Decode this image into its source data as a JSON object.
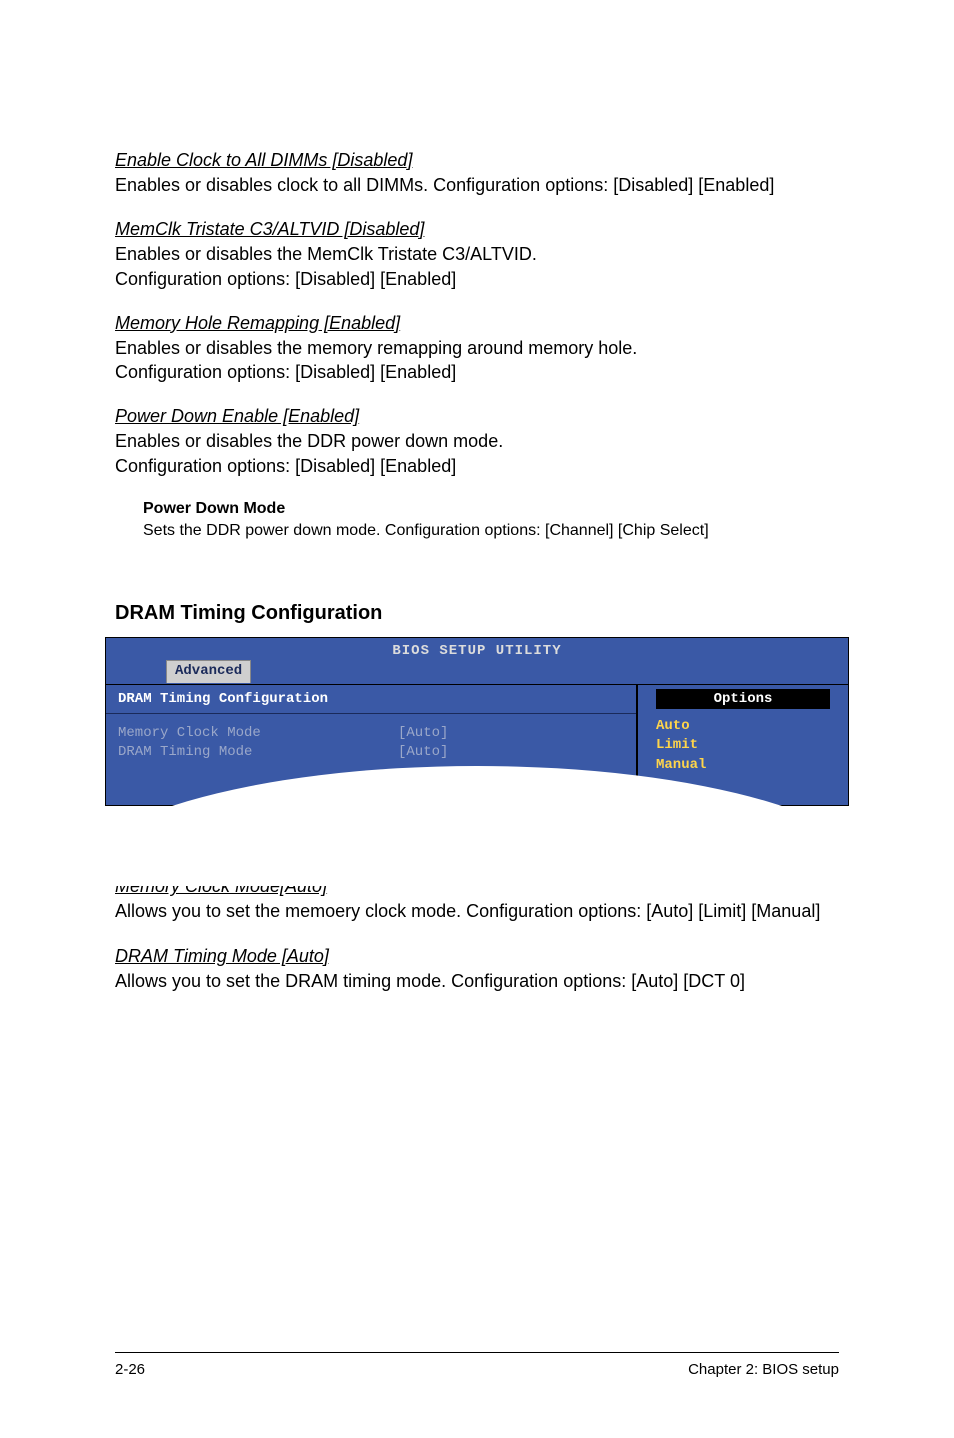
{
  "sections": {
    "s1": {
      "heading": "Enable Clock to All DIMMs [Disabled]",
      "text": "Enables or disables clock to all DIMMs. Configuration options: [Disabled] [Enabled]"
    },
    "s2": {
      "heading": "MemClk Tristate C3/ALTVID [Disabled]",
      "text": "Enables or disables the MemClk Tristate C3/ALTVID.\nConfiguration options: [Disabled] [Enabled]"
    },
    "s3": {
      "heading": "Memory Hole Remapping [Enabled]",
      "text": "Enables or disables the memory remapping around memory hole.\nConfiguration options: [Disabled] [Enabled]"
    },
    "s4": {
      "heading": "Power Down Enable [Enabled]",
      "text": "Enables or disables the DDR power down mode.\nConfiguration options: [Disabled] [Enabled]"
    },
    "sub": {
      "heading": "Power Down Mode",
      "text": "Sets the DDR power down mode. Configuration options: [Channel] [Chip Select]"
    },
    "dram_heading": "DRAM Timing Configuration",
    "s5": {
      "heading": "Memory Clock Mode[Auto]",
      "text": "Allows you to set the memoery clock mode. Configuration options: [Auto] [Limit] [Manual]"
    },
    "s6": {
      "heading": "DRAM Timing Mode [Auto]",
      "text": "Allows you to set the DRAM timing mode. Configuration options: [Auto] [DCT 0]"
    }
  },
  "bios": {
    "title": "BIOS SETUP UTILITY",
    "tab": "Advanced",
    "main_header": "DRAM Timing Configuration",
    "rows": [
      {
        "label": "Memory Clock Mode",
        "value": "[Auto]"
      },
      {
        "label": "DRAM Timing Mode",
        "value": "[Auto]"
      }
    ],
    "side_header": "Options",
    "options": [
      "Auto",
      "Limit",
      "Manual"
    ]
  },
  "footer": {
    "left": "2-26",
    "right": "Chapter 2: BIOS setup"
  }
}
